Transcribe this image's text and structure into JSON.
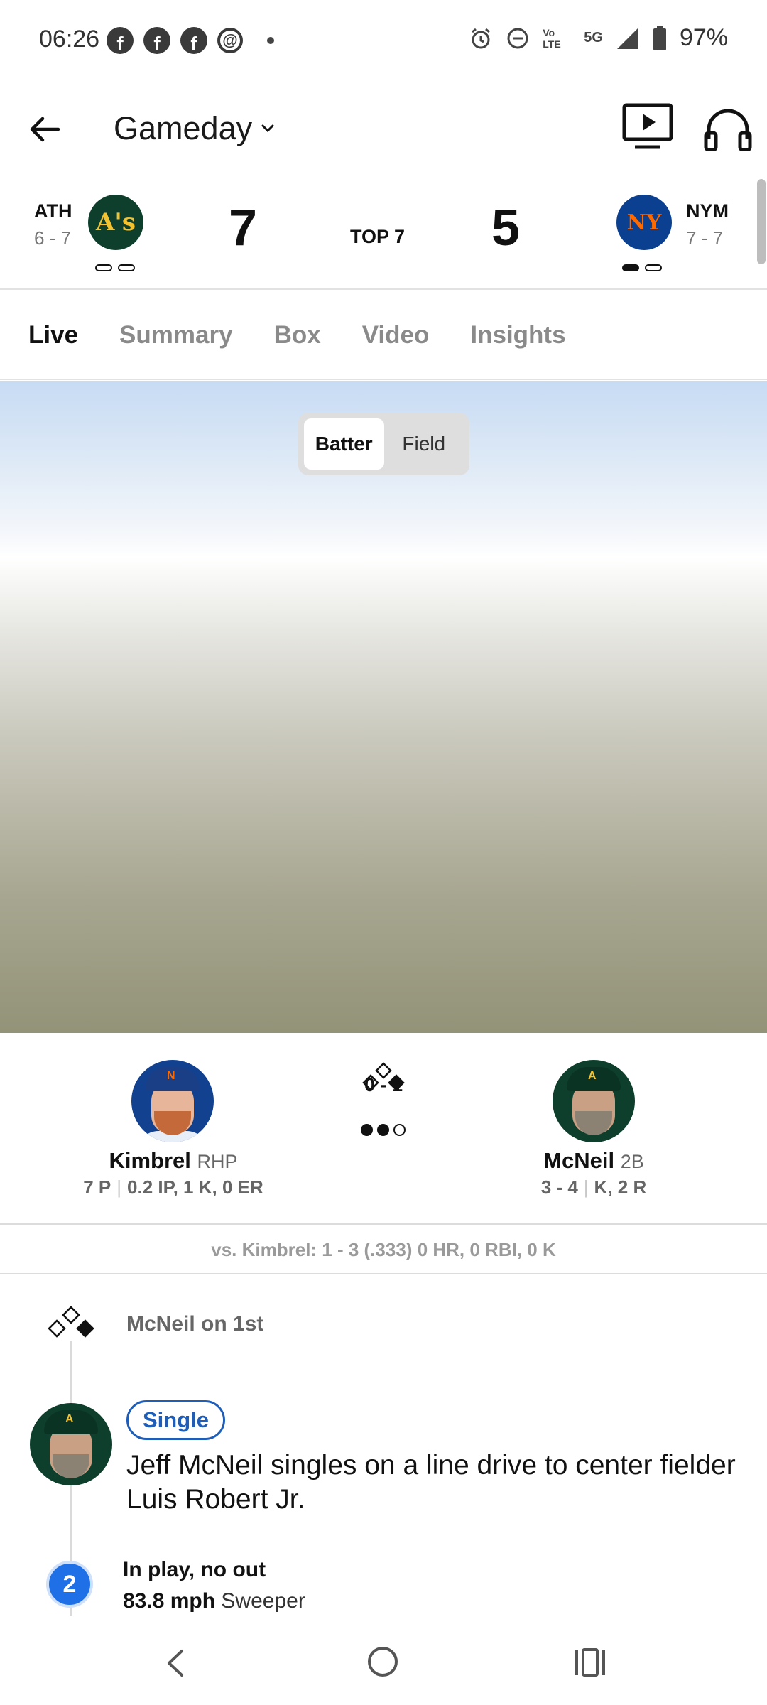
{
  "status": {
    "time": "06:26",
    "battery": "97%",
    "network": "5G",
    "volte": "Vo LTE"
  },
  "header": {
    "title": "Gameday"
  },
  "game": {
    "away": {
      "abbr": "ATH",
      "record": "6 - 7",
      "score": "7",
      "logo_text": "A's"
    },
    "home": {
      "abbr": "NYM",
      "record": "7 - 7",
      "score": "5",
      "logo_text": "NY"
    },
    "inning": "TOP 7"
  },
  "tabs": [
    "Live",
    "Summary",
    "Box",
    "Video",
    "Insights"
  ],
  "view_toggle": {
    "batter": "Batter",
    "field": "Field"
  },
  "matchup": {
    "pitcher": {
      "name": "Kimbrel",
      "pos": "RHP",
      "pitches": "7 P",
      "line": "0.2 IP, 1 K, 0 ER"
    },
    "batter": {
      "name": "McNeil",
      "pos": "2B",
      "today": "3 - 4",
      "line": "K, 2 R"
    },
    "count": "0 - 1",
    "outs": 2,
    "vs_line": "vs. Kimbrel: 1 - 3 (.333) 0 HR, 0 RBI, 0 K"
  },
  "feed": {
    "runner": "McNeil on 1st",
    "badge": "Single",
    "description": "Jeff McNeil singles on a line drive to center fielder Luis Robert Jr.",
    "pitch_number": "2",
    "pitch_result": "In play, no out",
    "pitch_speed": "83.8 mph",
    "pitch_type": "Sweeper"
  },
  "colors": {
    "accent_blue": "#1e5eb9",
    "ath_green": "#0e3f2d",
    "nym_blue": "#0b3f8f",
    "nym_orange": "#ff6a00"
  }
}
